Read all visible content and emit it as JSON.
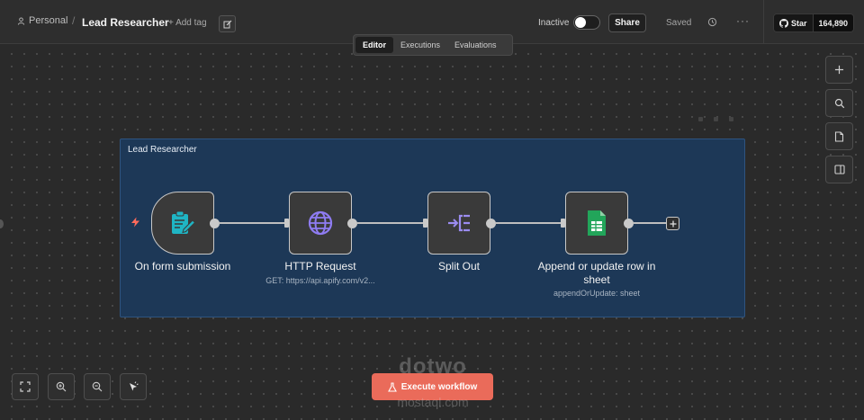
{
  "header": {
    "breadcrumb_personal": "Personal",
    "breadcrumb_separator": "/",
    "workflow_title": "Lead Researcher",
    "add_tag": "+ Add tag",
    "status_label": "Inactive",
    "active": false,
    "share_label": "Share",
    "saved_label": "Saved",
    "more_label": "···",
    "github_star_label": "Star",
    "github_star_count": "164,890"
  },
  "tabs": [
    {
      "label": "Editor",
      "active": true
    },
    {
      "label": "Executions",
      "active": false
    },
    {
      "label": "Evaluations",
      "active": false
    }
  ],
  "right_toolbar": [
    "plus-icon",
    "search-icon",
    "note-icon",
    "panel-icon"
  ],
  "group": {
    "title": "Lead Researcher"
  },
  "nodes": [
    {
      "label": "On form submission",
      "subtitle": "",
      "icon": "form-icon",
      "icon_color": "#1fb5c4"
    },
    {
      "label": "HTTP Request",
      "subtitle": "GET: https://api.apify.com/v2...",
      "icon": "globe-icon",
      "icon_color": "#8f7cf2"
    },
    {
      "label": "Split Out",
      "subtitle": "",
      "icon": "split-out-icon",
      "icon_color": "#9b8cf0"
    },
    {
      "label": "Append or update row in sheet",
      "label_line1": "Append or update row in",
      "label_line2": "sheet",
      "subtitle": "appendOrUpdate: sheet",
      "icon": "google-sheets-icon",
      "icon_color": "#22a55a"
    }
  ],
  "bottom_toolbar": [
    "fit-view-icon",
    "zoom-in-icon",
    "zoom-out-icon",
    "tidy-up-icon"
  ],
  "execute_label": "Execute workflow",
  "accent_color": "#ea6b5a",
  "watermark": {
    "main": "dotwo",
    "sub": "mostaql.com"
  }
}
